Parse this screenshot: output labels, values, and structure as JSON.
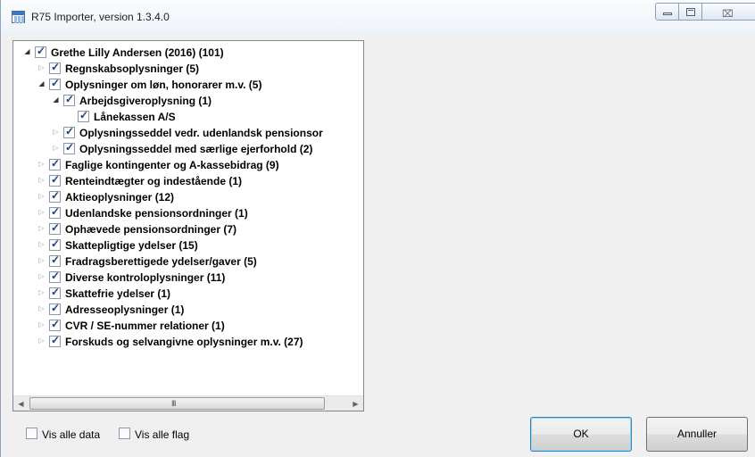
{
  "window": {
    "title": "R75 Importer, version 1.3.4.0",
    "close_glyph": "⌧"
  },
  "tree": {
    "items": [
      {
        "label": "Grethe Lilly Andersen (2016) (101)",
        "level": 0,
        "expander": "open",
        "checked": true
      },
      {
        "label": "Regnskabsoplysninger (5)",
        "level": 1,
        "expander": "closed",
        "checked": true
      },
      {
        "label": "Oplysninger om løn, honorarer m.v. (5)",
        "level": 1,
        "expander": "open",
        "checked": true
      },
      {
        "label": "Arbejdsgiveroplysning (1)",
        "level": 2,
        "expander": "open",
        "checked": true
      },
      {
        "label": "Lånekassen A/S",
        "level": 3,
        "expander": "none",
        "checked": true
      },
      {
        "label": "Oplysningsseddel vedr. udenlandsk pensionsor",
        "level": 2,
        "expander": "closed",
        "checked": true
      },
      {
        "label": "Oplysningsseddel med særlige ejerforhold (2)",
        "level": 2,
        "expander": "closed",
        "checked": true
      },
      {
        "label": "Faglige kontingenter og A-kassebidrag (9)",
        "level": 1,
        "expander": "closed",
        "checked": true
      },
      {
        "label": "Renteindtægter og indestående (1)",
        "level": 1,
        "expander": "closed",
        "checked": true
      },
      {
        "label": "Aktieoplysninger (12)",
        "level": 1,
        "expander": "closed",
        "checked": true
      },
      {
        "label": "Udenlandske pensionsordninger (1)",
        "level": 1,
        "expander": "closed",
        "checked": true
      },
      {
        "label": "Ophævede pensionsordninger (7)",
        "level": 1,
        "expander": "closed",
        "checked": true
      },
      {
        "label": "Skattepligtige ydelser (15)",
        "level": 1,
        "expander": "closed",
        "checked": true
      },
      {
        "label": "Fradragsberettigede ydelser/gaver (5)",
        "level": 1,
        "expander": "closed",
        "checked": true
      },
      {
        "label": "Diverse kontroloplysninger (11)",
        "level": 1,
        "expander": "closed",
        "checked": true
      },
      {
        "label": "Skattefrie ydelser (1)",
        "level": 1,
        "expander": "closed",
        "checked": true
      },
      {
        "label": "Adresseoplysninger (1)",
        "level": 1,
        "expander": "closed",
        "checked": true
      },
      {
        "label": "CVR / SE-nummer relationer (1)",
        "level": 1,
        "expander": "closed",
        "checked": true
      },
      {
        "label": "Forskuds og selvangivne oplysninger  m.v. (27)",
        "level": 1,
        "expander": "closed",
        "checked": true
      }
    ],
    "scrollbar_grip": "III"
  },
  "footer": {
    "show_all_data": {
      "label": "Vis alle data",
      "checked": false
    },
    "show_all_flags": {
      "label": "Vis alle flag",
      "checked": false
    },
    "ok_label": "OK",
    "cancel_label": "Annuller"
  }
}
